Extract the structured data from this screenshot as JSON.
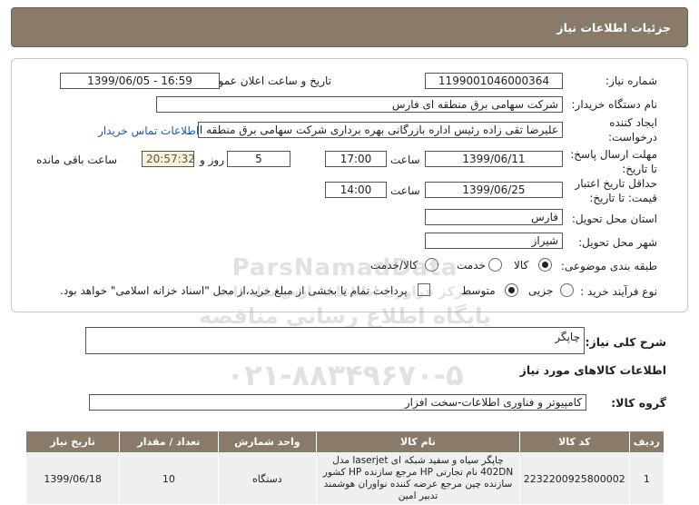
{
  "header": {
    "title": "جزئیات اطلاعات نیاز"
  },
  "form": {
    "need_number_label": "شماره نیاز:",
    "need_number": "1199001046000364",
    "announce_label": "تاریخ و ساعت اعلان عمومی:",
    "announce_value": "1399/06/05 - 16:59",
    "buyer_label": "نام دستگاه خریدار:",
    "buyer_value": "شرکت سهامی برق منطقه ای فارس",
    "creator_label_1": "ایجاد کننده",
    "creator_label_2": "درخواست:",
    "creator_value": "علیرضا  تقی زاده رئیس اداره بازرگانی بهره برداری شرکت سهامی برق منطقه ای",
    "contact_link": "اطلاعات تماس خریدار",
    "deadline_label_1": "مهلت ارسال پاسخ:",
    "deadline_label_2": "تا تاریخ:",
    "deadline_date": "1399/06/11",
    "time_label": "ساعت",
    "deadline_time": "17:00",
    "days_value": "5",
    "days_label": "روز و",
    "timer_value": "20:57:32",
    "remaining_label": "ساعت باقی مانده",
    "validity_label_1": "حداقل تاریخ اعتبار",
    "validity_label_2": "قیمت: تا تاریخ:",
    "validity_date": "1399/06/25",
    "validity_time": "14:00",
    "province_label": "استان محل تحویل:",
    "province_value": "فارس",
    "city_label": "شهر محل تحویل:",
    "city_value": "شیراز",
    "category_label": "طبقه بندی موضوعی:",
    "category_options": [
      "کالا",
      "خدمت",
      "کالا/خدمت"
    ],
    "process_label": "نوع فرآیند خرید :",
    "process_options": [
      "جزیی",
      "متوسط"
    ],
    "payment_note": "پرداخت تمام یا بخشی از مبلغ خرید،از محل \"اسناد خزانه اسلامی\" خواهد بود."
  },
  "summary": {
    "title": "شرح کلی نیاز:",
    "value": "چاپگر"
  },
  "goods_info": {
    "title": "اطلاعات کالاهای مورد نیاز"
  },
  "goods_group": {
    "label": "گروه کالا:",
    "value": "کامپیوتر و فناوری اطلاعات-سخت افزار"
  },
  "watermark": {
    "line1": "ParsNamadData",
    "line2": "مرکز فراوری اطلاعات پارس نماد داده",
    "line3": "پایگاه اطلاع رسانی مناقصه ومزایده",
    "line4": "۰۲۱-۸۸۳۴۹۶۷۰-۵"
  },
  "table": {
    "headers": [
      "ردیف",
      "کد کالا",
      "نام کالا",
      "واحد شمارش",
      "تعداد / مقدار",
      "تاریخ نیاز"
    ],
    "rows": [
      {
        "row": "1",
        "code": "2232200925800002",
        "name": "چاپگر سیاه و سفید شبکه ای laserjet مدل 402DN نام تجارتی HP مرجع سازنده HP کشور سازنده چین مرجع عرضه کننده نواوران هوشمند تدبیر امین",
        "unit": "دستگاه",
        "qty": "10",
        "date": "1399/06/18"
      }
    ]
  }
}
